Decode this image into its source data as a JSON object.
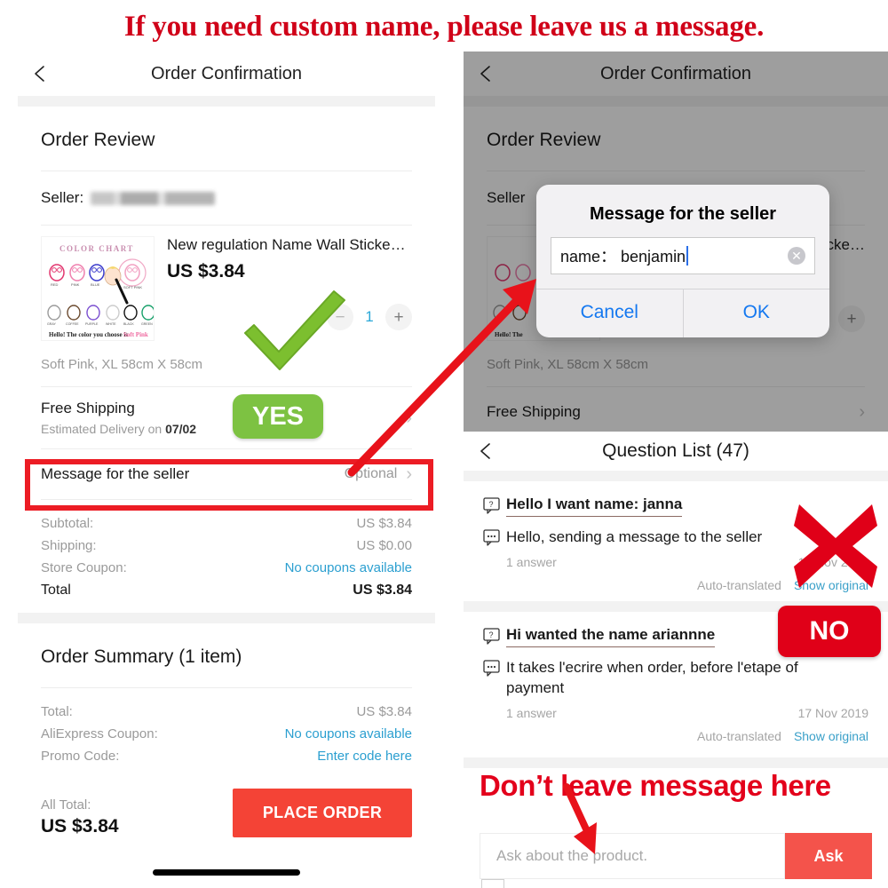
{
  "banner": {
    "text": "If you need custom name, please leave us a message."
  },
  "annotations": {
    "yes_badge": "YES",
    "no_badge": "NO",
    "dont_leave": "Don’t leave  message here",
    "check_icon": "green-check-icon",
    "cross_icon": "red-cross-icon",
    "arrow_to_dialog": "red-arrow-icon",
    "arrow_to_ask": "red-arrow-icon",
    "highlight_box": "red-highlight-box",
    "colors": {
      "banner_red": "#d00018",
      "yes_green": "#7dc242",
      "no_red": "#e00018",
      "box_red": "#ec1c24",
      "check_green": "#7cbf2f"
    }
  },
  "left_panel": {
    "navbar": {
      "title": "Order Confirmation",
      "back_icon": "chevron-left-icon"
    },
    "section_title": "Order Review",
    "seller": {
      "label": "Seller:",
      "value_blurred": true
    },
    "product": {
      "name": "New regulation Name Wall Sticke…",
      "price": "US $3.84",
      "quantity": "1",
      "minus_label": "−",
      "plus_label": "+",
      "variant": "Soft Pink, XL 58cm X 58cm",
      "thumb_caption": "Hello! The color you choose is Soft Pink",
      "thumb_heading": "COLOR CHART",
      "thumb_swatch_labels": [
        "RED",
        "PINK",
        "BLUE",
        "SOFT PINK",
        "GRAY",
        "COFFEE",
        "PURPLE",
        "WHITE",
        "BLACK",
        "GREEN"
      ]
    },
    "shipping_row": {
      "title": "Free Shipping",
      "subtitle_prefix": "Estimated Delivery on ",
      "subtitle_date": "07/02",
      "chevron": "chevron-right-icon"
    },
    "message_row": {
      "title": "Message for the seller",
      "value": "Optional",
      "chevron": "chevron-right-icon"
    },
    "price_lines": [
      {
        "key": "Subtotal:",
        "value": "US $3.84",
        "link": false
      },
      {
        "key": "Shipping:",
        "value": "US $0.00",
        "link": false
      },
      {
        "key": "Store Coupon:",
        "value": "No coupons available",
        "link": true
      }
    ],
    "total_line": {
      "key": "Total",
      "value": "US $3.84"
    },
    "order_summary": {
      "title": "Order Summary (1 item)",
      "lines": [
        {
          "key": "Total:",
          "value": "US $3.84",
          "link": false
        },
        {
          "key": "AliExpress Coupon:",
          "value": "No coupons available",
          "link": true
        },
        {
          "key": "Promo Code:",
          "value": "Enter code here",
          "link": true
        }
      ],
      "all_total_label": "All Total:",
      "all_total_value": "US $3.84",
      "place_order_label": "PLACE ORDER"
    }
  },
  "right_panel": {
    "navbar": {
      "title": "Order Confirmation",
      "back_icon": "chevron-left-icon"
    },
    "section_title": "Order Review",
    "seller_label": "Seller",
    "product_name_tail": "cke…",
    "variant": "Soft Pink, XL 58cm X 58cm",
    "shipping_title": "Free Shipping",
    "plus_label": "+",
    "dialog": {
      "title": "Message for the seller",
      "input_value": "name： benjamin",
      "clear_icon": "clear-circle-icon",
      "cancel_label": "Cancel",
      "ok_label": "OK"
    },
    "question_list": {
      "navbar": {
        "title": "Question List (47)",
        "back_icon": "chevron-left-icon"
      },
      "items": [
        {
          "question_icon": "question-bubble-icon",
          "question": "Hello I want name: janna",
          "answer_icon": "answer-bubble-icon",
          "answer": "Hello, sending a message to the seller",
          "answers_count": "1 answer",
          "date": "17 Nov 2019",
          "auto_translated": "Auto-translated",
          "show_original": "Show original"
        },
        {
          "question_icon": "question-bubble-icon",
          "question": "Hi wanted the name ariannne",
          "answer_icon": "answer-bubble-icon",
          "answer": "It takes l'ecrire when order, before l'etape of payment",
          "answers_count": "1 answer",
          "date": "17 Nov 2019",
          "auto_translated": "Auto-translated",
          "show_original": "Show original"
        }
      ],
      "ask_placeholder": "Ask about the product.",
      "ask_button": "Ask"
    }
  }
}
